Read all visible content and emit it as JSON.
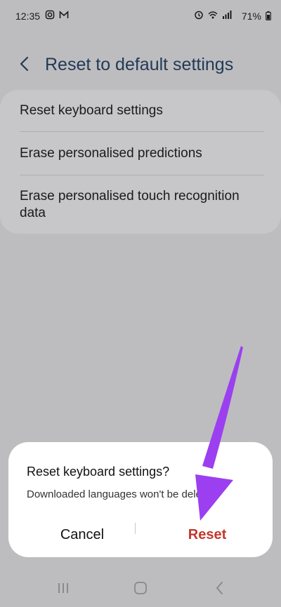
{
  "status_bar": {
    "time": "12:35",
    "battery": "71%"
  },
  "header": {
    "title": "Reset to default settings"
  },
  "settings": {
    "items": [
      {
        "label": "Reset keyboard settings"
      },
      {
        "label": "Erase personalised predictions"
      },
      {
        "label": "Erase personalised touch recognition data"
      }
    ]
  },
  "dialog": {
    "title": "Reset keyboard settings?",
    "message": "Downloaded languages won't be deleted.",
    "cancel_label": "Cancel",
    "reset_label": "Reset"
  },
  "colors": {
    "accent": "#9b3ff0",
    "reset_text": "#c4372e",
    "title_text": "#233a56"
  },
  "icons": {
    "status_left": [
      "instagram-icon",
      "gmail-icon"
    ],
    "status_right": [
      "alarm-icon",
      "wifi-calling-icon",
      "signal-icon",
      "battery-icon"
    ],
    "nav": [
      "recents-icon",
      "home-icon",
      "back-icon"
    ]
  }
}
